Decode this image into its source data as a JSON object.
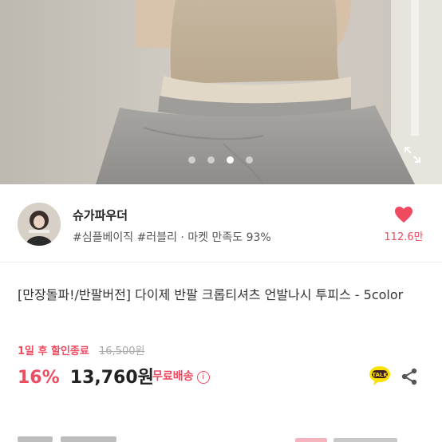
{
  "seller": {
    "name": "슈가파우더",
    "tags": "#심플베이직 #러블리 · 마켓 만족도 93%",
    "likes": "112.6만"
  },
  "product": {
    "title": "[만장돌파!/반팔버전] 다이제 반팔 크롭티셔츠 언발나시 투피스 - 5color",
    "timesale_label": "1일 후 할인종료",
    "original_price": "16,500원",
    "discount": "16%",
    "price": "13,760원",
    "shipping": "무료배송"
  },
  "carousel": {
    "count": 4,
    "active": 3
  },
  "icons": {
    "expand": "expand-icon",
    "like": "heart-icon",
    "talk": "kakaotalk-icon",
    "share": "share-icon",
    "info": "info-icon"
  },
  "colors": {
    "accent": "#ef4b60",
    "talk_yellow": "#fae100",
    "talk_brown": "#3c1e1e"
  }
}
